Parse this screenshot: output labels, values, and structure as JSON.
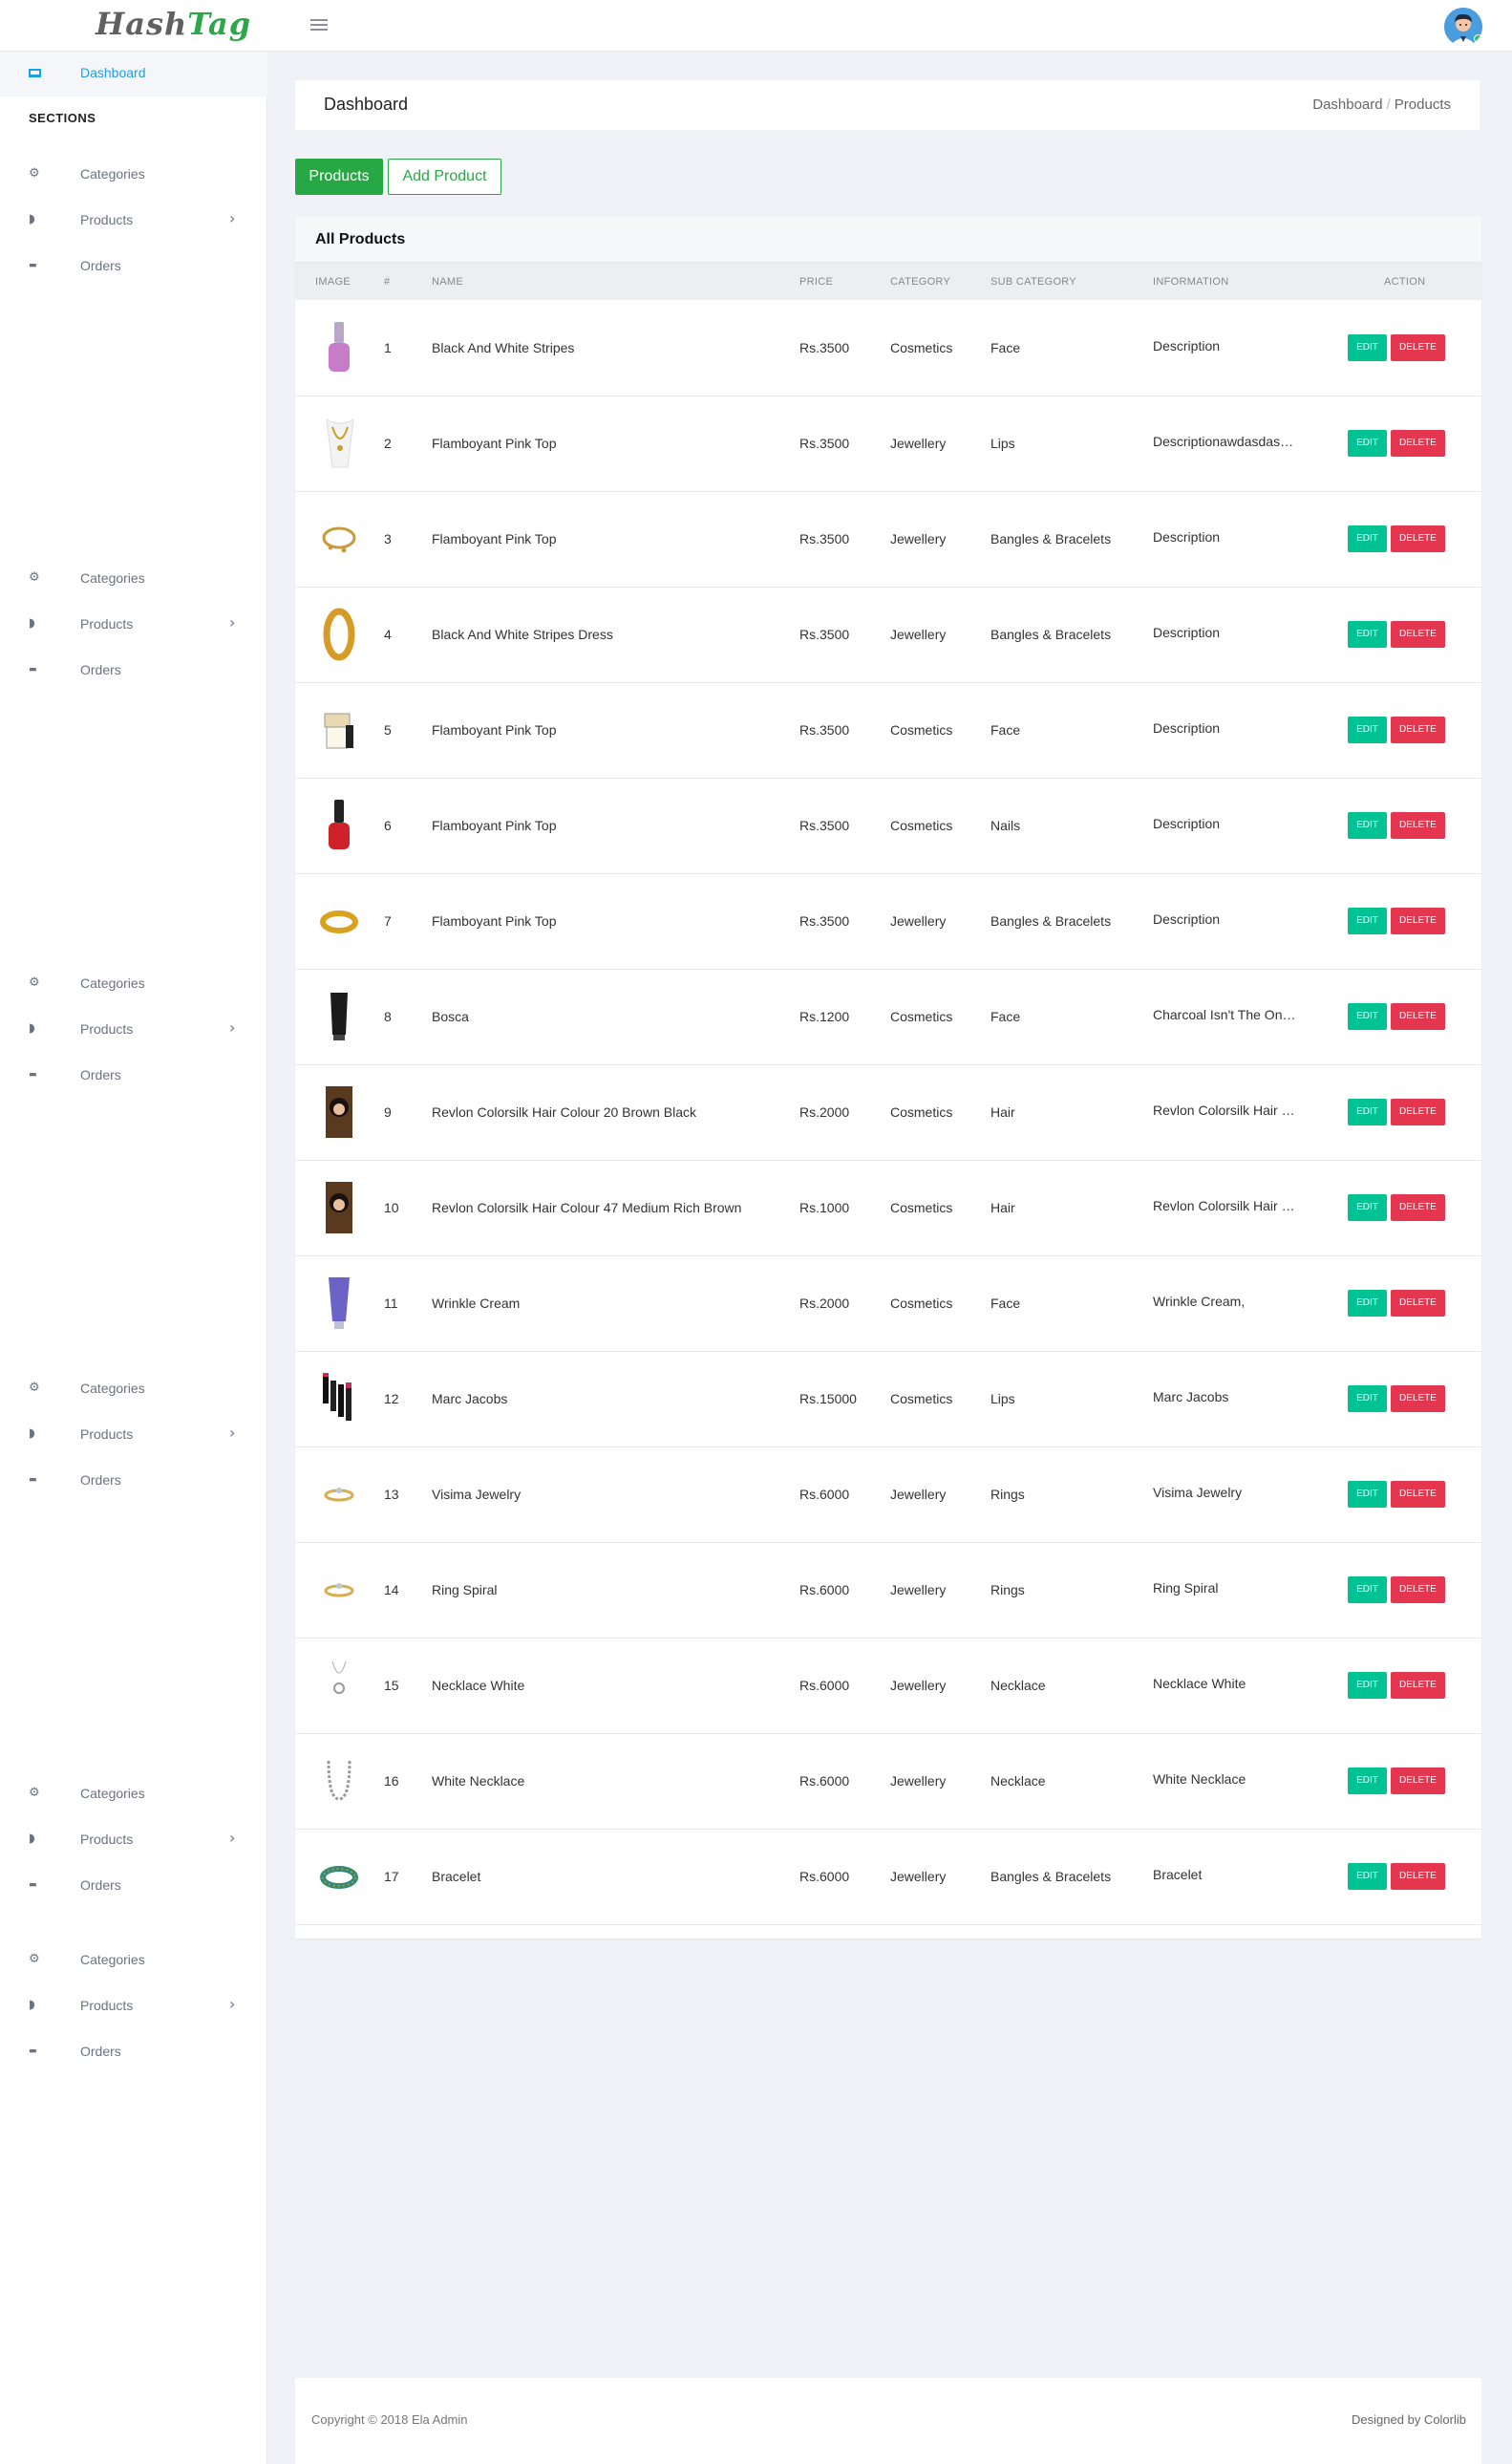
{
  "header": {
    "logo_main": "Hash",
    "logo_accent": "Tag"
  },
  "breadcrumb": {
    "items": [
      "Dashboard",
      "Products"
    ]
  },
  "page": {
    "title": "Dashboard"
  },
  "toolbar": {
    "products_label": "Products",
    "add_label": "Add Product"
  },
  "sidebar": {
    "dashboard_label": "Dashboard",
    "section_heading": "SECTIONS",
    "groups": [
      [
        "Categories",
        "Products",
        "Orders"
      ],
      [
        "Categories",
        "Products",
        "Orders"
      ],
      [
        "Categories",
        "Products",
        "Orders"
      ],
      [
        "Categories",
        "Products",
        "Orders"
      ],
      [
        "Categories",
        "Products",
        "Orders"
      ],
      [
        "Categories",
        "Products",
        "Orders"
      ]
    ]
  },
  "table": {
    "title": "All Products",
    "columns": [
      "IMAGE",
      "#",
      "NAME",
      "PRICE",
      "CATEGORY",
      "SUB CATEGORY",
      "INFORMATION",
      "ACTION"
    ],
    "edit_label": "EDIT",
    "delete_label": "DELETE",
    "rows": [
      {
        "num": "1",
        "name": "Black And White Stripes",
        "price": "Rs.3500",
        "category": "Cosmetics",
        "subcategory": "Face",
        "info": "Description",
        "image": "nail-polish-purple"
      },
      {
        "num": "2",
        "name": "Flamboyant Pink Top",
        "price": "Rs.3500",
        "category": "Jewellery",
        "subcategory": "Lips",
        "info": "Descriptionawdasdasdasd",
        "image": "gold-necklace"
      },
      {
        "num": "3",
        "name": "Flamboyant Pink Top",
        "price": "Rs.3500",
        "category": "Jewellery",
        "subcategory": "Bangles & Bracelets",
        "info": "Description",
        "image": "charm-bracelet"
      },
      {
        "num": "4",
        "name": "Black And White Stripes Dress",
        "price": "Rs.3500",
        "category": "Jewellery",
        "subcategory": "Bangles & Bracelets",
        "info": "Description",
        "image": "gold-bangle"
      },
      {
        "num": "5",
        "name": "Flamboyant Pink Top",
        "price": "Rs.3500",
        "category": "Cosmetics",
        "subcategory": "Face",
        "info": "Description",
        "image": "cream-jar"
      },
      {
        "num": "6",
        "name": "Flamboyant Pink Top",
        "price": "Rs.3500",
        "category": "Cosmetics",
        "subcategory": "Nails",
        "info": "Description",
        "image": "nail-polish-red"
      },
      {
        "num": "7",
        "name": "Flamboyant Pink Top",
        "price": "Rs.3500",
        "category": "Jewellery",
        "subcategory": "Bangles & Bracelets",
        "info": "Description",
        "image": "gold-bracelet"
      },
      {
        "num": "8",
        "name": "Bosca",
        "price": "Rs.1200",
        "category": "Cosmetics",
        "subcategory": "Face",
        "info": "Charcoal Isn't The Only Thing",
        "image": "black-tube"
      },
      {
        "num": "9",
        "name": "Revlon Colorsilk Hair Colour 20 Brown Black",
        "price": "Rs.2000",
        "category": "Cosmetics",
        "subcategory": "Hair",
        "info": "Revlon Colorsilk Hair Colour",
        "image": "hair-colour-box"
      },
      {
        "num": "10",
        "name": "Revlon Colorsilk Hair Colour 47 Medium Rich Brown",
        "price": "Rs.1000",
        "category": "Cosmetics",
        "subcategory": "Hair",
        "info": "Revlon Colorsilk Hair Colour",
        "image": "hair-colour-box"
      },
      {
        "num": "11",
        "name": "Wrinkle Cream",
        "price": "Rs.2000",
        "category": "Cosmetics",
        "subcategory": "Face",
        "info": "Wrinkle Cream,",
        "image": "blue-tube"
      },
      {
        "num": "12",
        "name": "Marc Jacobs",
        "price": "Rs.15000",
        "category": "Cosmetics",
        "subcategory": "Lips",
        "info": "Marc Jacobs",
        "image": "lipstick-set"
      },
      {
        "num": "13",
        "name": "Visima Jewelry",
        "price": "Rs.6000",
        "category": "Jewellery",
        "subcategory": "Rings",
        "info": "Visima Jewelry",
        "image": "ring"
      },
      {
        "num": "14",
        "name": "Ring Spiral",
        "price": "Rs.6000",
        "category": "Jewellery",
        "subcategory": "Rings",
        "info": "Ring Spiral",
        "image": "ring"
      },
      {
        "num": "15",
        "name": "Necklace White",
        "price": "Rs.6000",
        "category": "Jewellery",
        "subcategory": "Necklace",
        "info": "Necklace White",
        "image": "pendant"
      },
      {
        "num": "16",
        "name": "White Necklace",
        "price": "Rs.6000",
        "category": "Jewellery",
        "subcategory": "Necklace",
        "info": "White Necklace",
        "image": "silver-necklace"
      },
      {
        "num": "17",
        "name": "Bracelet",
        "price": "Rs.6000",
        "category": "Jewellery",
        "subcategory": "Bangles & Bracelets",
        "info": "Bracelet",
        "image": "beaded-bracelet"
      }
    ]
  },
  "footer": {
    "copyright": "Copyright © 2018 Ela Admin",
    "credit": "Designed by Colorlib"
  },
  "colors": {
    "primary_green": "#28a745",
    "edit": "#00c292",
    "delete": "#e4364e",
    "sidebar_active": "#1ea0e0"
  }
}
